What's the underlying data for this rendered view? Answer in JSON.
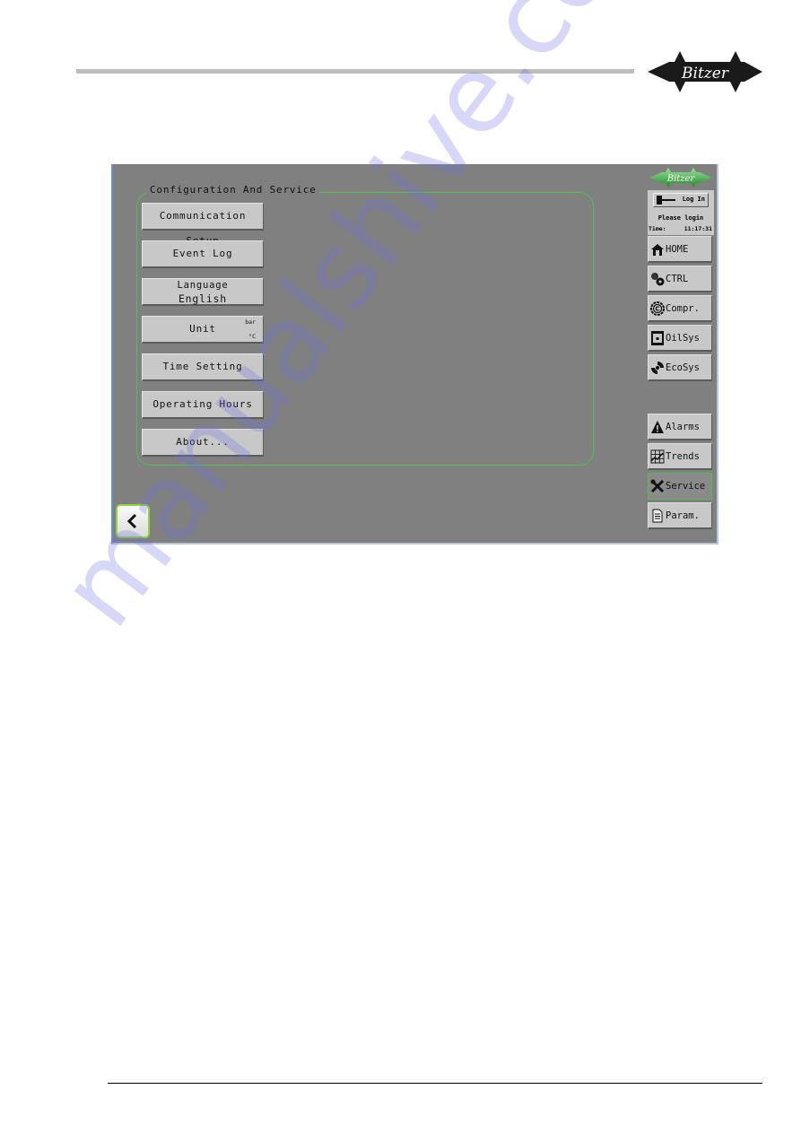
{
  "document": {
    "brand": "Bitzer",
    "watermark": "manualshive.com"
  },
  "screen": {
    "group_title": "Configuration And Service",
    "menu": [
      {
        "id": "communication-setup",
        "label": "Communication Setup"
      },
      {
        "id": "event-log",
        "label": "Event Log"
      },
      {
        "id": "language",
        "label": "Language",
        "value": "English"
      },
      {
        "id": "unit",
        "label": "Unit",
        "pressure_unit": "bar",
        "temperature_unit": "°C"
      },
      {
        "id": "time-setting",
        "label": "Time Setting"
      },
      {
        "id": "operating-hours",
        "label": "Operating Hours"
      },
      {
        "id": "about",
        "label": "About..."
      }
    ],
    "back_button": {
      "icon": "chevron-left-icon"
    },
    "sidebar": {
      "logo": "Bitzer",
      "login": {
        "button_label": "Log In",
        "icon": "key-icon",
        "message": "Please login",
        "time_label": "Time:",
        "time_value": "11:17:31"
      },
      "nav": [
        {
          "id": "home",
          "label": "HOME",
          "icon": "home-icon"
        },
        {
          "id": "ctrl",
          "label": "CTRL",
          "icon": "gears-icon"
        },
        {
          "id": "compr",
          "label": "Compr.",
          "icon": "compressor-icon"
        },
        {
          "id": "oilsys",
          "label": "OilSys",
          "icon": "oil-tank-icon"
        },
        {
          "id": "ecosys",
          "label": "EcoSys",
          "icon": "eco-icon"
        },
        {
          "id": "alarms",
          "label": "Alarms",
          "icon": "warning-icon"
        },
        {
          "id": "trends",
          "label": "Trends",
          "icon": "trend-chart-icon"
        },
        {
          "id": "service",
          "label": "Service",
          "icon": "tools-icon",
          "active": true
        },
        {
          "id": "param",
          "label": "Param.",
          "icon": "document-icon"
        }
      ]
    },
    "colors": {
      "screen_bg": "#808080",
      "button_bg": "#c8c8c8",
      "accent_green": "#4fc04f",
      "logo_green": "#2fa33a"
    }
  }
}
